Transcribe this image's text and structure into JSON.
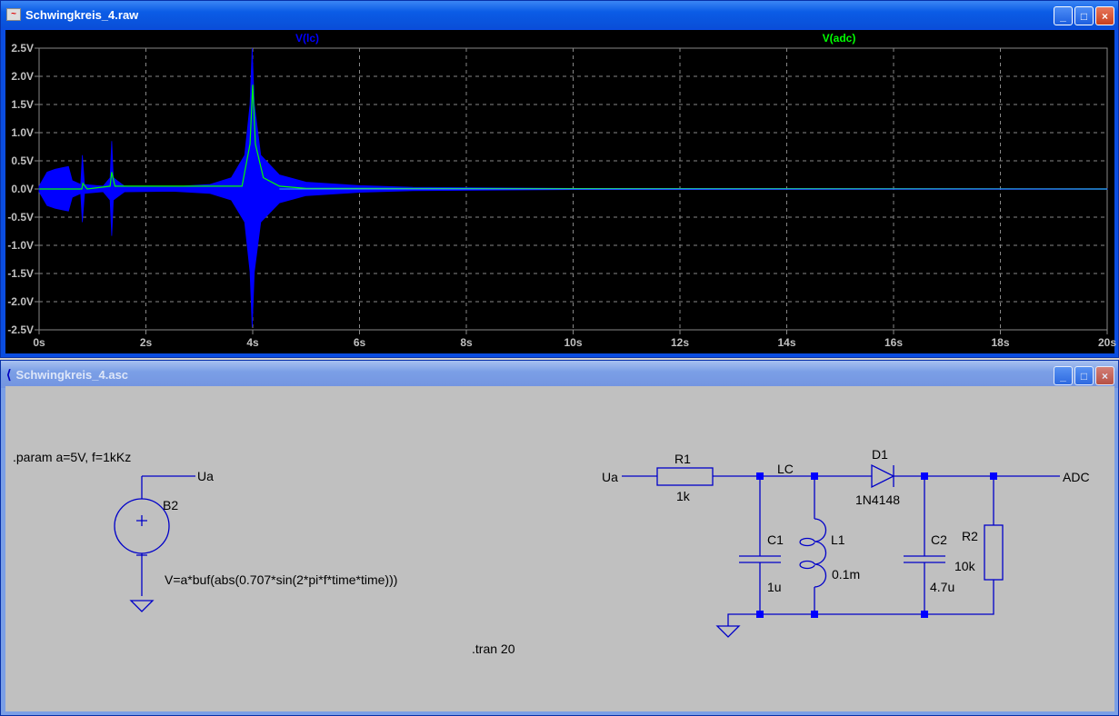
{
  "plot_window": {
    "title": "Schwingkreis_4.raw",
    "icon": "waveform-icon",
    "buttons": [
      "_",
      "□",
      "×"
    ]
  },
  "schematic_window": {
    "title": "Schwingkreis_4.asc",
    "icon": "ltspice-icon",
    "buttons": [
      "_",
      "□",
      "×"
    ]
  },
  "chart_data": {
    "type": "line",
    "xlabel": "",
    "ylabel": "",
    "xlim": [
      0,
      20
    ],
    "ylim": [
      -2.5,
      2.5
    ],
    "x_ticks": [
      "0s",
      "2s",
      "4s",
      "6s",
      "8s",
      "10s",
      "12s",
      "14s",
      "16s",
      "18s",
      "20s"
    ],
    "y_ticks": [
      "2.5V",
      "2.0V",
      "1.5V",
      "1.0V",
      "0.5V",
      "0.0V",
      "-0.5V",
      "-1.0V",
      "-1.5V",
      "-2.0V",
      "-2.5V"
    ],
    "grid": true,
    "series": [
      {
        "name": "V(lc)",
        "color": "#0000ff",
        "kind": "envelope",
        "points": [
          [
            0,
            0.05
          ],
          [
            0.15,
            0.3
          ],
          [
            0.3,
            0.35
          ],
          [
            0.45,
            0.38
          ],
          [
            0.55,
            0.4
          ],
          [
            0.62,
            0.15
          ],
          [
            0.78,
            0.08
          ],
          [
            0.81,
            0.6
          ],
          [
            0.85,
            0.08
          ],
          [
            1.2,
            0.05
          ],
          [
            1.33,
            0.2
          ],
          [
            1.36,
            0.85
          ],
          [
            1.39,
            0.2
          ],
          [
            1.6,
            0.05
          ],
          [
            2.5,
            0.04
          ],
          [
            3.2,
            0.08
          ],
          [
            3.6,
            0.2
          ],
          [
            3.85,
            0.6
          ],
          [
            3.95,
            1.5
          ],
          [
            3.99,
            2.5
          ],
          [
            4.03,
            1.5
          ],
          [
            4.15,
            0.6
          ],
          [
            4.5,
            0.25
          ],
          [
            5,
            0.12
          ],
          [
            6,
            0.06
          ],
          [
            7,
            0.03
          ],
          [
            10,
            0.01
          ],
          [
            20,
            0.005
          ]
        ]
      },
      {
        "name": "V(adc)",
        "color": "#00ff00",
        "kind": "line",
        "points": [
          [
            0,
            0
          ],
          [
            0.8,
            0
          ],
          [
            0.82,
            0.1
          ],
          [
            0.9,
            0
          ],
          [
            1.33,
            0.05
          ],
          [
            1.36,
            0.3
          ],
          [
            1.42,
            0.05
          ],
          [
            3.8,
            0.05
          ],
          [
            3.95,
            0.8
          ],
          [
            4.0,
            1.85
          ],
          [
            4.05,
            0.8
          ],
          [
            4.2,
            0.2
          ],
          [
            4.5,
            0.05
          ],
          [
            5,
            0.01
          ],
          [
            20,
            0
          ]
        ]
      }
    ]
  },
  "schematic": {
    "param": ".param a=5V, f=1kKz",
    "ua_label": "Ua",
    "b2": "B2",
    "b2_value": "V=a*buf(abs(0.707*sin(2*pi*f*time*time)))",
    "tran": ".tran 20",
    "ua_in": "Ua",
    "r1": "R1",
    "r1_value": "1k",
    "lc": "LC",
    "d1": "D1",
    "d1_value": "1N4148",
    "c1": "C1",
    "c1_value": "1u",
    "l1": "L1",
    "l1_value": "0.1m",
    "c2": "C2",
    "c2_value": "4.7u",
    "r2": "R2",
    "r2_value": "10k",
    "adc": "ADC"
  }
}
